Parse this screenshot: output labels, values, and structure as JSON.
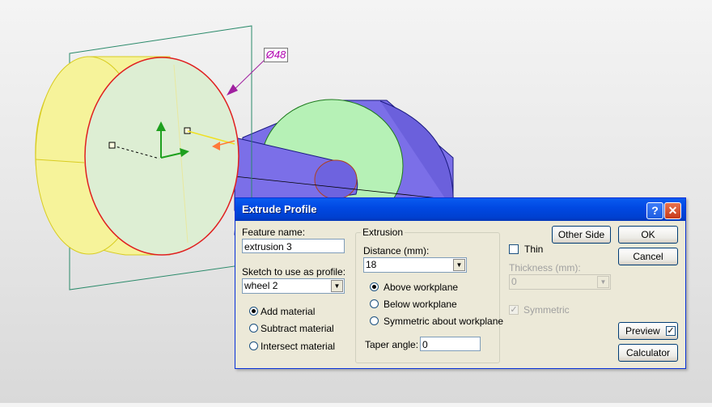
{
  "viewport": {
    "dimension_label": "Ø48"
  },
  "dialog": {
    "title": "Extrude Profile",
    "help_glyph": "?",
    "close_glyph": "✕",
    "feature_name_label": "Feature name:",
    "feature_name_value": "extrusion 3",
    "sketch_label": "Sketch to use as profile:",
    "sketch_value": "wheel 2",
    "material": {
      "add": "Add material",
      "subtract": "Subtract material",
      "intersect": "Intersect material",
      "selected": "add"
    },
    "extrusion": {
      "group_title": "Extrusion",
      "distance_label": "Distance (mm):",
      "distance_value": "18",
      "above": "Above workplane",
      "below": "Below workplane",
      "symmetric": "Symmetric about workplane",
      "selected": "above",
      "taper_label": "Taper angle:",
      "taper_value": "0"
    },
    "other_side_label": "Other Side",
    "thin_label": "Thin",
    "thickness_label": "Thickness (mm):",
    "thickness_value": "0",
    "symmetric_label": "Symmetric",
    "ok_label": "OK",
    "cancel_label": "Cancel",
    "preview_label": "Preview",
    "calculator_label": "Calculator",
    "check_glyph": "✓",
    "arrow_glyph": "▼"
  },
  "colors": {
    "wheel_face": "#ddeed3",
    "wheel_rim": "#f6f39a",
    "hub_face": "#b6f1b6",
    "shaft": "#7b6fe8",
    "dialog_bg": "#ece9d8",
    "title_blue": "#0149e3"
  }
}
